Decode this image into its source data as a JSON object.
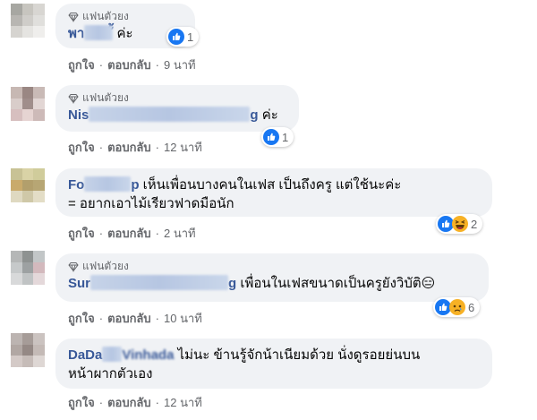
{
  "colors": {
    "bubble": "#f0f2f5",
    "name": "#385898",
    "meta": "#65676b",
    "like": "#1877f2",
    "haha": "#f7b125"
  },
  "comments": [
    {
      "badge": "แฟนตัวยง",
      "name": "พา",
      "name_tail": "ั้",
      "text": "ค่ะ",
      "like_label": "ถูกใจ",
      "reply_label": "ตอบกลับ",
      "time": "9 นาที",
      "reactions": {
        "icons": [
          "like-icon"
        ],
        "count": "1"
      }
    },
    {
      "badge": "แฟนตัวยง",
      "name": "Nis",
      "name_tail": "g",
      "text": "ค่ะ",
      "like_label": "ถูกใจ",
      "reply_label": "ตอบกลับ",
      "time": "12 นาที",
      "reactions": {
        "icons": [
          "like-icon"
        ],
        "count": "1"
      }
    },
    {
      "name": "Fo",
      "name_tail": "p",
      "text": "เห็นเพื่อนบางคนในเฟส เป็นถึงครู แต่ใช้นะค่ะ",
      "text_line2": "= อยากเอาไม้เรียวฟาดมือนัก",
      "like_label": "ถูกใจ",
      "reply_label": "ตอบกลับ",
      "time": "2 นาที",
      "reactions": {
        "icons": [
          "like-icon",
          "haha-icon"
        ],
        "count": "2"
      }
    },
    {
      "badge": "แฟนตัวยง",
      "name": "Sur",
      "name_tail": "g",
      "text": "เพื่อนในเฟสขนาดเป็นครูยังวิบัติ😑",
      "like_label": "ถูกใจ",
      "reply_label": "ตอบกลับ",
      "time": "10 นาที",
      "reactions": {
        "icons": [
          "like-icon",
          "sad-icon"
        ],
        "count": "6"
      }
    },
    {
      "name": "DaDa",
      "name_tail": "Vinhada",
      "text": "ไม่นะ ข้านรู้จักน้าเนียมด้วย นั่งดูรอยย่นบน",
      "text_line2": "หน้าผากตัวเอง",
      "like_label": "ถูกใจ",
      "reply_label": "ตอบกลับ",
      "time": "12 นาที"
    }
  ]
}
